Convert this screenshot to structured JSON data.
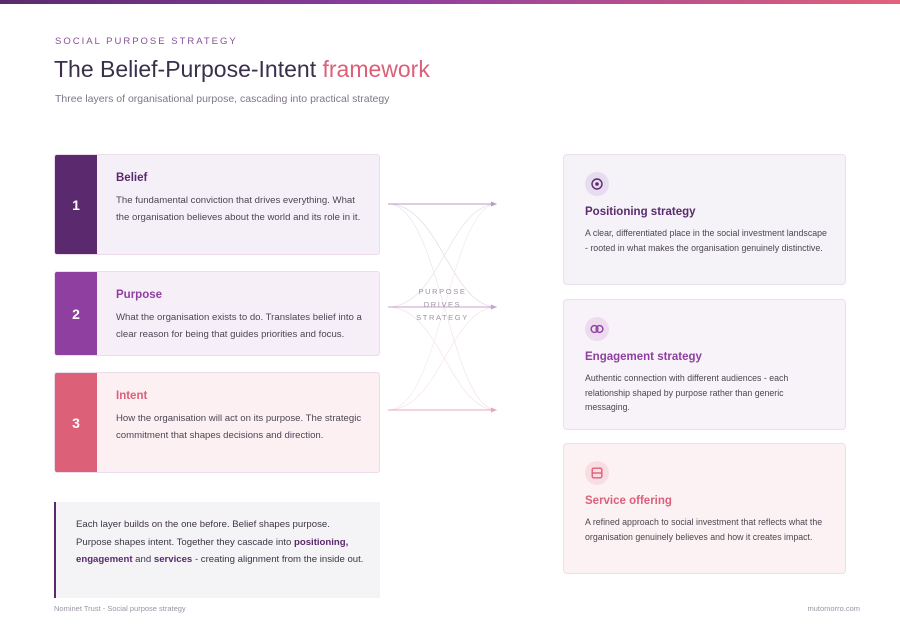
{
  "header": {
    "eyebrow": "SOCIAL PURPOSE STRATEGY",
    "title_main": "The Belief-Purpose-Intent ",
    "title_accent": "framework",
    "subtitle": "Three layers of organisational purpose, cascading into practical strategy"
  },
  "layers": [
    {
      "number": "1",
      "name": "Belief",
      "description": "The fundamental conviction that drives everything. What the organisation believes about the world and its role in it.",
      "color": "#5b2a6e"
    },
    {
      "number": "2",
      "name": "Purpose",
      "description": "What the organisation exists to do. Translates belief into a clear reason for being that guides priorities and focus.",
      "color": "#8e3fa0"
    },
    {
      "number": "3",
      "name": "Intent",
      "description": "How the organisation will act on its purpose. The strategic commitment that shapes decisions and direction.",
      "color": "#dc6078"
    }
  ],
  "connector": {
    "line1": "PURPOSE",
    "line2": "DRIVES",
    "line3": "STRATEGY"
  },
  "strategies": [
    {
      "icon": "target-icon",
      "name": "Positioning strategy",
      "description": "A clear, differentiated place in the social investment landscape - rooted in what makes the organisation genuinely distinctive."
    },
    {
      "icon": "link-icon",
      "name": "Engagement strategy",
      "description": "Authentic connection with different audiences - each relationship shaped by purpose rather than generic messaging."
    },
    {
      "icon": "service-icon",
      "name": "Service offering",
      "description": "A refined approach to social investment that reflects what the organisation genuinely believes and how it creates impact."
    }
  ],
  "note": {
    "text_1": "Each layer builds on the one before. Belief shapes purpose. Purpose shapes intent. Together they cascade into ",
    "hl_1": "positioning",
    "text_2": ", ",
    "hl_2": "engagement",
    "text_3": " and ",
    "hl_3": "services",
    "text_4": " - creating alignment from the inside out."
  },
  "footer": {
    "left": "Nominet Trust - Social purpose strategy",
    "right": "mutomorro.com"
  },
  "colors": {
    "belief": "#5b2a6e",
    "purpose": "#8e3fa0",
    "intent": "#dc6078"
  }
}
